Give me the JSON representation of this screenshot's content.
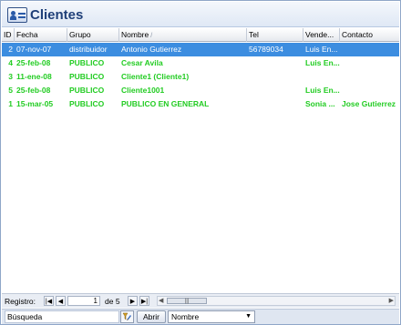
{
  "title": "Clientes",
  "columns": [
    {
      "label": "ID"
    },
    {
      "label": "Fecha"
    },
    {
      "label": "Grupo"
    },
    {
      "label": "Nombre"
    },
    {
      "label": "Tel"
    },
    {
      "label": "Vende..."
    },
    {
      "label": "Contacto"
    }
  ],
  "sort_indicator": "/",
  "rows": [
    {
      "id": "2",
      "fecha": "07-nov-07",
      "grupo": "distribuidor",
      "nombre": "Antonio Gutierrez",
      "tel": "56789034",
      "vendedor": "Luis En...",
      "contacto": ""
    },
    {
      "id": "4",
      "fecha": "25-feb-08",
      "grupo": "PUBLICO",
      "nombre": "Cesar Avila",
      "tel": "",
      "vendedor": "Luis En...",
      "contacto": ""
    },
    {
      "id": "3",
      "fecha": "11-ene-08",
      "grupo": "PUBLICO",
      "nombre": "Cliente1  (Cliente1)",
      "tel": "",
      "vendedor": "",
      "contacto": ""
    },
    {
      "id": "5",
      "fecha": "25-feb-08",
      "grupo": "PUBLICO",
      "nombre": "Cliente1001",
      "tel": "",
      "vendedor": "Luis En...",
      "contacto": ""
    },
    {
      "id": "1",
      "fecha": "15-mar-05",
      "grupo": "PUBLICO",
      "nombre": "PUBLICO EN GENERAL",
      "tel": "",
      "vendedor": "Sonia ...",
      "contacto": "Jose Gutierrez"
    }
  ],
  "navigation": {
    "label": "Registro:",
    "current": "1",
    "of_text": "de 5",
    "first_icon": "first-record-icon",
    "prev_icon": "prev-record-icon",
    "next_icon": "next-record-icon",
    "last_icon": "last-record-icon"
  },
  "search": {
    "label": "Búsqueda",
    "open_button": "Abrir",
    "field_select": "Nombre"
  },
  "colors": {
    "selected_row": "#3c8de0",
    "row_text": "#22cc22",
    "title_text": "#1f3f78"
  }
}
